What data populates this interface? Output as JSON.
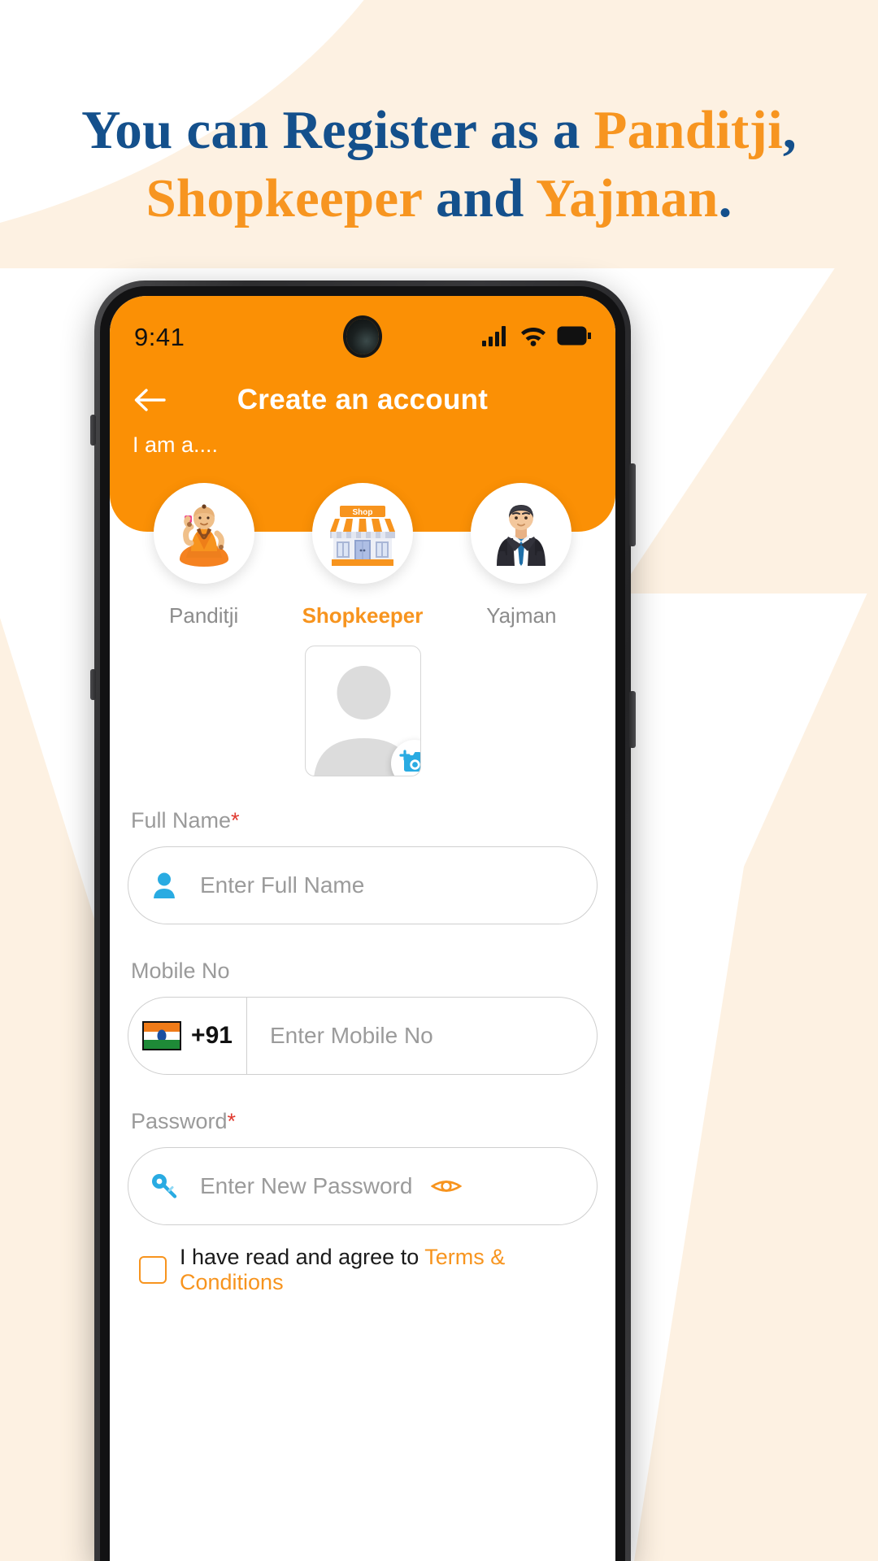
{
  "promo": {
    "line1_part1": "You can Register as a ",
    "line1_part2": "Panditji",
    "line1_part3": ",",
    "line2_part1": "Shopkeeper",
    "line2_part2": " and ",
    "line2_part3": "Yajman",
    "line2_part4": "."
  },
  "colors": {
    "brand_orange": "#FB9005",
    "accent_orange": "#F7941E",
    "headline_blue": "#14508C",
    "cream": "#FDF1E2",
    "icon_blue": "#29ABE2",
    "required_red": "#E03A30"
  },
  "status_bar": {
    "time": "9:41",
    "signal_icon": "signal-bars-icon",
    "wifi_icon": "wifi-icon",
    "battery_icon": "battery-full-icon"
  },
  "app_bar": {
    "back_icon": "arrow-left-icon",
    "title": "Create an account",
    "subtitle": "I am a...."
  },
  "roles": {
    "items": [
      {
        "id": "panditji",
        "label": "Panditji",
        "icon": "priest-illustration",
        "selected": false
      },
      {
        "id": "shopkeeper",
        "label": "Shopkeeper",
        "icon": "shop-storefront-illustration",
        "selected": true
      },
      {
        "id": "yajman",
        "label": "Yajman",
        "icon": "businessman-illustration",
        "selected": false
      }
    ],
    "shop_sign_text": "Shop"
  },
  "avatar": {
    "placeholder_icon": "person-silhouette-icon",
    "upload_badge_icon": "add-camera-icon"
  },
  "form": {
    "full_name": {
      "label": "Full Name",
      "required_mark": "*",
      "placeholder": "Enter Full Name",
      "value": "",
      "lead_icon": "person-icon"
    },
    "mobile": {
      "label": "Mobile No",
      "required_mark": "",
      "country_flag_icon": "india-flag-icon",
      "country_code": "+91",
      "placeholder": "Enter Mobile No",
      "value": ""
    },
    "password": {
      "label": "Password",
      "required_mark": "*",
      "placeholder": "Enter New Password",
      "value": "",
      "lead_icon": "key-icon",
      "toggle_icon": "eye-icon"
    },
    "terms": {
      "checked": false,
      "text": "I have read and agree to ",
      "link": "Terms & Conditions"
    }
  }
}
